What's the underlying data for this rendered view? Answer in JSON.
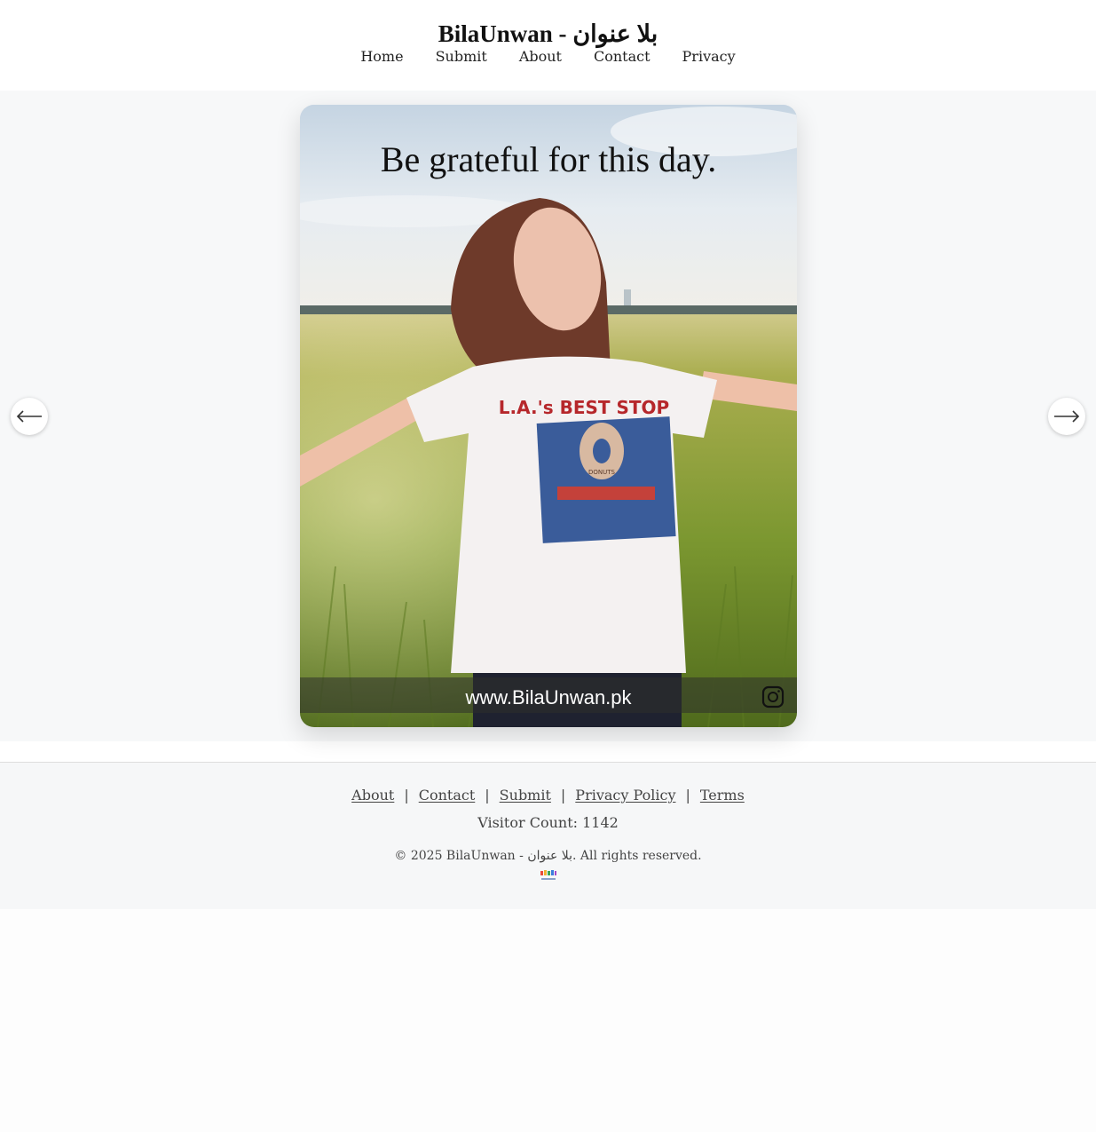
{
  "site": {
    "title": "BilaUnwan - بلا عنوان"
  },
  "nav": {
    "items": [
      {
        "label": "Home"
      },
      {
        "label": "Submit"
      },
      {
        "label": "About"
      },
      {
        "label": "Contact"
      },
      {
        "label": "Privacy"
      }
    ]
  },
  "slider": {
    "quote": "Be grateful for this day.",
    "shirt_text": "L.A.'s BEST STOP",
    "donut_text": "DONUTS",
    "watermark": "www.BilaUnwan.pk",
    "prev_icon": "arrow-left-icon",
    "next_icon": "arrow-right-icon"
  },
  "footer": {
    "links": [
      {
        "label": "About"
      },
      {
        "label": "Contact"
      },
      {
        "label": "Submit"
      },
      {
        "label": "Privacy Policy"
      },
      {
        "label": "Terms"
      }
    ],
    "separator": "|",
    "visitor_count": "Visitor Count: 1142",
    "copyright": "© 2025 BilaUnwan - بلا عنوان. All rights reserved.",
    "logo_text": "BILA UNWAN"
  }
}
